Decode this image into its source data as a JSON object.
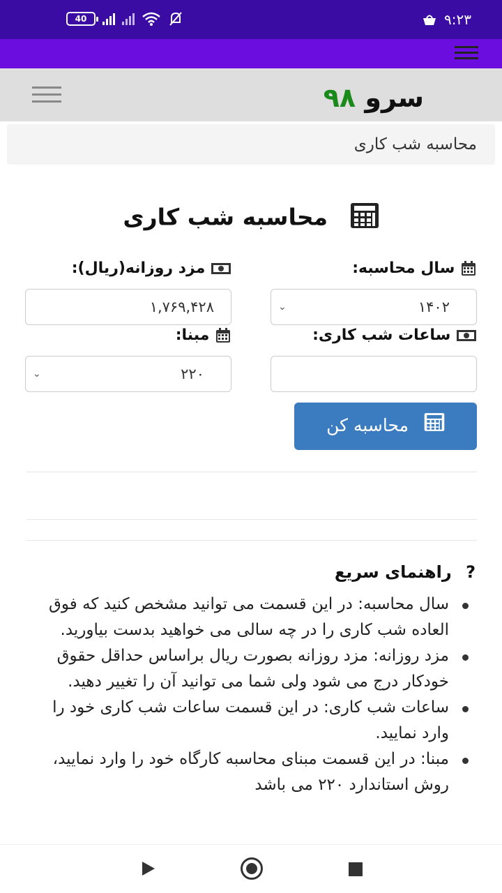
{
  "status": {
    "battery": "40",
    "time": "۹:۲۳"
  },
  "header": {
    "logo_word": "سرو",
    "logo_num": "۹۸"
  },
  "breadcrumb": "محاسبه شب کاری",
  "title": "محاسبه شب کاری",
  "form": {
    "year_label": "سال محاسبه:",
    "year_value": "۱۴۰۲",
    "wage_label": "مزد روزانه(ریال):",
    "wage_value": "۱,۷۶۹,۴۲۸",
    "hours_label": "ساعات شب کاری:",
    "hours_value": "",
    "base_label": "مبنا:",
    "base_value": "۲۲۰",
    "button_label": "محاسبه کن"
  },
  "help": {
    "title": "راهنمای سریع",
    "items": [
      "سال محاسبه: در این قسمت می توانید مشخص کنید که فوق العاده شب کاری را در چه سالی می خواهید بدست بیاورید.",
      "مزد روزانه: مزد روزانه بصورت ریال براساس حداقل حقوق خودکار درج می شود ولی شما می توانید آن را تغییر دهید.",
      "ساعات شب کاری: در این قسمت ساعات شب کاری خود را وارد نمایید.",
      "مبنا: در این قسمت مبنای محاسبه کارگاه خود را وارد نمایید، روش استاندارد ۲۲۰ می باشد"
    ]
  },
  "colors": {
    "status_bar": "#3a0ca3",
    "app_bar": "#6a0dde",
    "button": "#3a7cbf",
    "logo_accent": "#1a8a1a"
  }
}
